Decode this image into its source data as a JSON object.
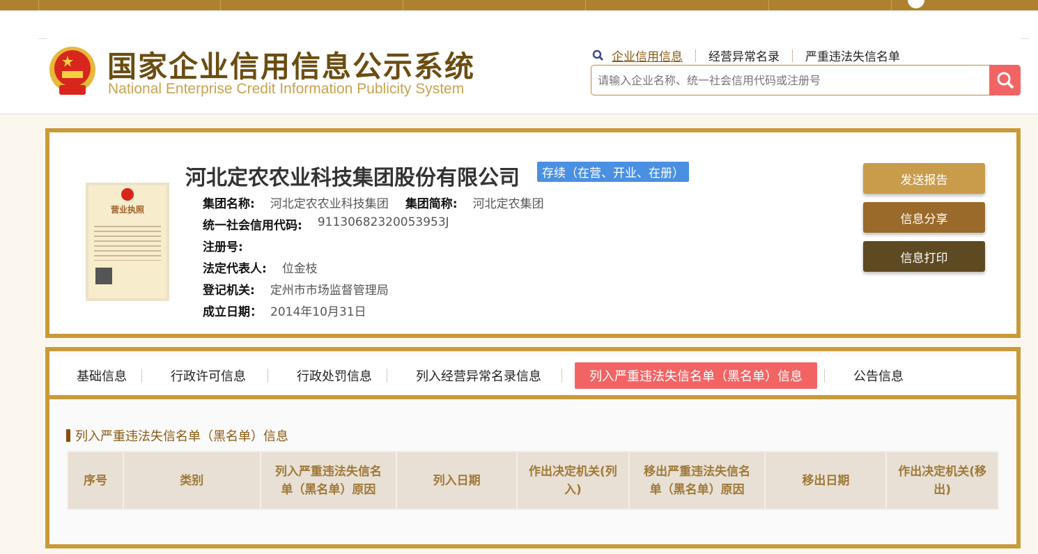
{
  "header": {
    "logo_cn": "国家企业信用信息公示系统",
    "logo_en": "National Enterprise Credit Information Publicity System",
    "links": [
      "企业信用信息",
      "经营异常名录",
      "严重违法失信名单"
    ],
    "search_placeholder": "请输入企业名称、统一社会信用代码或注册号"
  },
  "company": {
    "name": "河北定农农业科技集团股份有限公司",
    "status": "存续（在营、开业、在册）",
    "licence_title": "营业执照",
    "fields": [
      {
        "label": "集团名称:",
        "value": "河北定农农业科技集团"
      },
      {
        "label": "集团简称:",
        "value": "河北定农集团"
      },
      {
        "label": "统一社会信用代码:",
        "value": "91130682320053953J"
      },
      {
        "label": "注册号:",
        "value": ""
      },
      {
        "label": "法定代表人:",
        "value": "位金枝"
      },
      {
        "label": "登记机关:",
        "value": "定州市市场监督管理局"
      },
      {
        "label": "成立日期：",
        "value": "2014年10月31日"
      }
    ],
    "actions": [
      "发送报告",
      "信息分享",
      "信息打印"
    ]
  },
  "tabs": [
    "基础信息",
    "行政许可信息",
    "行政处罚信息",
    "列入经营异常名录信息",
    "列入严重违法失信名单（黑名单）信息",
    "公告信息"
  ],
  "active_tab": 4,
  "section_title": "列入严重违法失信名单（黑名单）信息",
  "table": {
    "headers": [
      "序号",
      "类别",
      "列入严重违法失信名单（黑名单）原因",
      "列入日期",
      "作出决定机关(列入)",
      "移出严重违法失信名单（黑名单）原因",
      "移出日期",
      "作出决定机关(移出)"
    ]
  },
  "colors": {
    "gold": "#c99a3a",
    "topbar": "#ad812f",
    "accent_red": "#f26464",
    "status_blue": "#4a90e2"
  }
}
